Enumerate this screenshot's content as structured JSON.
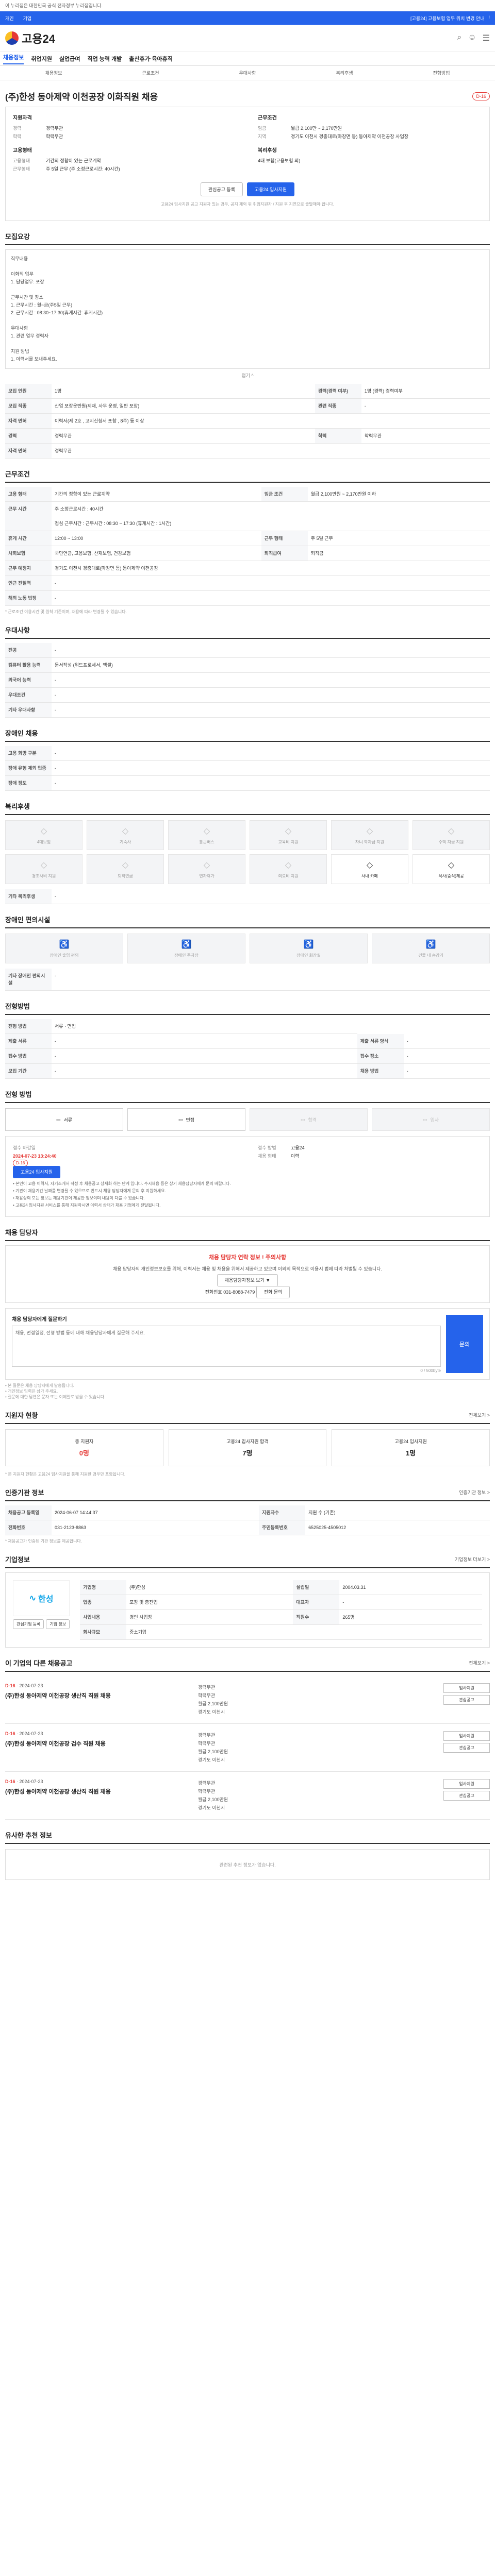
{
  "topbar": {
    "notice": "이 누리집은 대한민국 공식 전자정부 누리집입니다."
  },
  "bluebar": {
    "items": [
      "개인",
      "기업"
    ],
    "right": [
      "[고용24] 고용보험 업무 위치 변경 안내",
      "!"
    ]
  },
  "header": {
    "logo": "고용24"
  },
  "gnb": {
    "items": [
      "채용정보",
      "취업지원",
      "실업급여",
      "직업 능력 개발",
      "출산휴가·육아휴직"
    ]
  },
  "subnav": {
    "items": [
      "채용정보",
      "근로조건",
      "우대사항",
      "복리후생",
      "전형방법"
    ]
  },
  "job": {
    "title": "(주)한성 동아제약 이천공장 이화직원 채용",
    "badge": "D-16",
    "apply_k": "지원자격",
    "pref_k": "근무조건",
    "apply": [
      {
        "k": "경력",
        "v": "경력무관"
      },
      {
        "k": "학력",
        "v": "학력무관"
      }
    ],
    "cond": [
      {
        "k": "임금",
        "v": "월급 2,100만 ~ 2,170만원"
      },
      {
        "k": "지역",
        "v": "경기도 이천시 경충대로(마장면 등) 동아제약 이천공장 사업장"
      }
    ],
    "etc_k": "고용형태",
    "etc": [
      {
        "k": "고용형태",
        "v": "기간의 정함이 있는 근로계약"
      },
      {
        "k": "근무형태",
        "v": "주 5일 근무 (주 소정근로시간: 40시간)"
      }
    ],
    "welfare_k": "복리후생",
    "welfare": "4대 보험(고용보험 외)",
    "btn_save": "관심공고 등록",
    "btn_apply": "고용24 입사지원",
    "note": "고용24 입사지원 공고 지원자 있는 경우, 공지 제외 위 취업지원자 / 지원 후 지연으로 출발해야 합니다."
  },
  "recruit": {
    "head": "모집요강",
    "duty_h": "직무내용",
    "text": "직무내용\n\n이화직 업무\n1. 담당업무: 포장\n\n근무시간 및 장소\n1. 근무시간 : 월~금(주5일 근무)\n2. 근무시간 : 08:30~17:30(휴게시간: 휴게시간)\n\n우대사항\n1. 관련 업무 경력자\n\n지원 방법\n1. 이력서를 보내주세요.",
    "fold": "접기 ^",
    "rows": [
      [
        "모집 인원",
        "1명",
        "경력(경력 여부)",
        "1명 (경력) 경력여부"
      ],
      [
        "모집 직종",
        "산업 포장운반원(제재, 사무 운영, 일반 포장)",
        "관련 직종",
        "-"
      ],
      [
        "자격 면허",
        "이력서(제 2호 , 고지신청서 포함 , 8주) 등 이상",
        null,
        null
      ],
      [
        "경력",
        "경력무관",
        "학력",
        "학력무관"
      ],
      [
        "자격 면허",
        "경력무관",
        null,
        null
      ]
    ]
  },
  "cond": {
    "head": "근무조건",
    "rows": [
      [
        "고용 형태",
        "기간의 정함이 있는 근로계약",
        "임금 조건",
        "월급 2,100만원 ~ 2,170만원 이하"
      ],
      [
        "근무 시간",
        "주 소정근로시간 : 40시간\n\n점심 근무시간 : 근무시간 : 08:30 ~ 17:30 (휴게시간 : 1시간)",
        null,
        null
      ],
      [
        "휴게 시간",
        "12:00 ~ 13:00",
        "근무 형태",
        "주 5일 근무"
      ],
      [
        "사회보험",
        "국민연금, 고용보험, 산재보험, 건강보험",
        "퇴직급여",
        "퇴직금"
      ],
      [
        "근무 예정지",
        "경기도 이천시 경충대로(마장면 등) 동아제약 이천공장",
        null,
        null
      ],
      [
        "인근 전철역",
        "-",
        null,
        null
      ],
      [
        "해외 노동 법정",
        "-",
        null,
        null
      ]
    ],
    "mini": "* 근로조건 이용시간 및 원칙 기준이며, 채용에 따라 변경될 수 있습니다."
  },
  "pref": {
    "head": "우대사항",
    "rows": [
      [
        "전공",
        "-"
      ],
      [
        "컴퓨터 활용 능력",
        "문서작성 (워드프로세서, 엑셀)"
      ],
      [
        "외국어 능력",
        "-"
      ],
      [
        "우대조건",
        "-"
      ],
      [
        "기타 우대사항",
        "-"
      ]
    ]
  },
  "disab": {
    "head": "장애인 채용",
    "rows": [
      [
        "고용 희망 구분",
        "-"
      ],
      [
        "장애 유형 제외 업종",
        "-"
      ],
      [
        "장애 정도",
        "-"
      ]
    ]
  },
  "welfare": {
    "head": "복리후생",
    "items": [
      "4대보험",
      "기숙사",
      "통근버스",
      "교육비 지원",
      "자녀 학자금 지원",
      "주택 자금 지원",
      "경조사비 지원",
      "퇴직연금",
      "연차휴가",
      "의료비 지원",
      "사내 카페",
      "식사(중식)제공"
    ],
    "on": [
      10,
      11
    ],
    "etc_k": "기타 복리후생",
    "etc_v": "-"
  },
  "disab_welfare": {
    "head": "장애인 편의시설",
    "items": [
      "장애인 출입 편의",
      "장애인 주차장",
      "장애인 화장실",
      "건물 내 승강기"
    ],
    "etc_k": "기타 장애인 편의시설",
    "etc_v": "-"
  },
  "proc": {
    "head": "전형방법",
    "rows": [
      [
        "전형 방법",
        "서류 · 면접"
      ],
      [
        "제출 서류",
        "-",
        "제출 서류 양식",
        "-"
      ],
      [
        "접수 방법",
        "-",
        "접수 장소",
        "-"
      ],
      [
        "모집 기간",
        "-",
        "채용 방법",
        "-"
      ]
    ]
  },
  "steps": {
    "head": "전형 방법",
    "items": [
      "서류",
      "면접",
      "합격",
      "입사"
    ],
    "off": [
      2,
      3
    ]
  },
  "period": {
    "k1": "접수 마감일",
    "v1": "2024-07-23 13:24:40",
    "badge": "D-16",
    "k2": "접수 방법",
    "v2": "고용24",
    "k3": "채용 형태",
    "v3": "이력",
    "btn": "고용24 입사지원",
    "lines": [
      "• 본인이 고용 이력서, 자기소개서 작성 후 채용공고 상세화 하는 단계 입니다. 수시채용 등은 상기 채용담당자에게 문의 바랍니다.",
      "• 기관이 채용기간 날짜를 변경될 수 있으므로 반드시 채용 담당자에게 문의 후 지원하세요.",
      "• 채용상의 모든 정보는 채용기관이 제공한 정보이며 내용이 다를 수 있습니다.",
      "• 고용24 입사지원 서비스를 통해 지원하시면 이력서 상태가 채용 기업에게 전달됩니다."
    ]
  },
  "manager": {
    "head": "채용 담당자",
    "warn": "채용 담당자 연락 정보 ! 주의사항",
    "msg": "채용 담당자의 개인정보보호를 위해, 이력서는 채용 및 채용을 위해서 제공하고 있으며 이외의 목적으로 이용시 법에 따라 처벌될 수 있습니다.",
    "btn": "채용담당자정보 보기 ▼",
    "phone_k": "전화번호",
    "phone_v": "031-8088-7479",
    "phone_btn": "전화 문의",
    "q_h": "채용 담당자에게 질문하기",
    "q_ph": "채용, 면접일정, 전형 방법 등에 대해 채용담당자에게 질문해 주세요.",
    "q_btn": "문의",
    "q_count": "0 / 500byte",
    "q_notes": [
      "• 본 질문은 채용 담당자에게 발송됩니다.",
      "• 개인정보 입력은 삼가 주세요.",
      "• 질문에 대한 답변은 문자 또는 이메일로 받을 수 있습니다."
    ]
  },
  "status": {
    "head": "지원자 현황",
    "more": "전체보기 >",
    "items": [
      {
        "k": "총 지원자",
        "v": "0명",
        "red": true
      },
      {
        "k": "고용24 입사지원 합격",
        "v": "7명",
        "red": false
      },
      {
        "k": "고용24 입사지원",
        "v": "1명",
        "red": false
      }
    ],
    "mini": "* 본 지원자 현황은 고용24 입사지원을 통해 지원한 경우만 포함됩니다."
  },
  "info": {
    "head": "인증기관 정보",
    "more": "인증기관 정보 >",
    "rows": [
      [
        "채용공고 등록일",
        "2024-06-07 14:44:37",
        "지원자수",
        "지원 수 (기존)"
      ],
      [
        "전화번호",
        "031-2123-8863",
        "주민등록번호",
        "6525025-4505012"
      ]
    ],
    "mini": "* 채용공고가 인증된 기관 정보를 제공합니다."
  },
  "company": {
    "head": "기업정보",
    "more": "기업정보 더보기 >",
    "logo": "한성",
    "rows": [
      [
        "기업명",
        "(주)한성",
        "설립일",
        "2004.03.31"
      ],
      [
        "업종",
        "포장 및 충전업",
        "대표자",
        "-"
      ],
      [
        "사업내용",
        "경인 사업장",
        "직원수",
        "265명"
      ],
      [
        "회사규모",
        "중소기업",
        null,
        null
      ]
    ],
    "btn1": "관심기업 등록",
    "btn2": "기업 정보"
  },
  "others": {
    "head": "이 기업의 다른 채용공고",
    "more": "전체보기 >",
    "jobs": [
      {
        "tag": "D-16",
        "date": "2024-07-23",
        "title": "(주)한성 동아제약 이천공장 생산직 직원 채용",
        "meta": [
          "경력무관",
          "학력무관",
          "월급 2,100만원",
          "경기도 이천시"
        ],
        "btns": [
          "입사지원",
          "관심공고"
        ]
      },
      {
        "tag": "D-16",
        "date": "2024-07-23",
        "title": "(주)한성 동아제약 이천공장 검수 직원 채용",
        "meta": [
          "경력무관",
          "학력무관",
          "월급 2,100만원",
          "경기도 이천시"
        ],
        "btns": [
          "입사지원",
          "관심공고"
        ]
      },
      {
        "tag": "D-16",
        "date": "2024-07-23",
        "title": "(주)한성 동아제약 이천공장 생산직 직원 채용",
        "meta": [
          "경력무관",
          "학력무관",
          "월급 2,100만원",
          "경기도 이천시"
        ],
        "btns": [
          "입사지원",
          "관심공고"
        ]
      }
    ]
  },
  "similar": {
    "head": "유사한 추천 정보",
    "empty": "관련된 추천 정보가 없습니다."
  }
}
